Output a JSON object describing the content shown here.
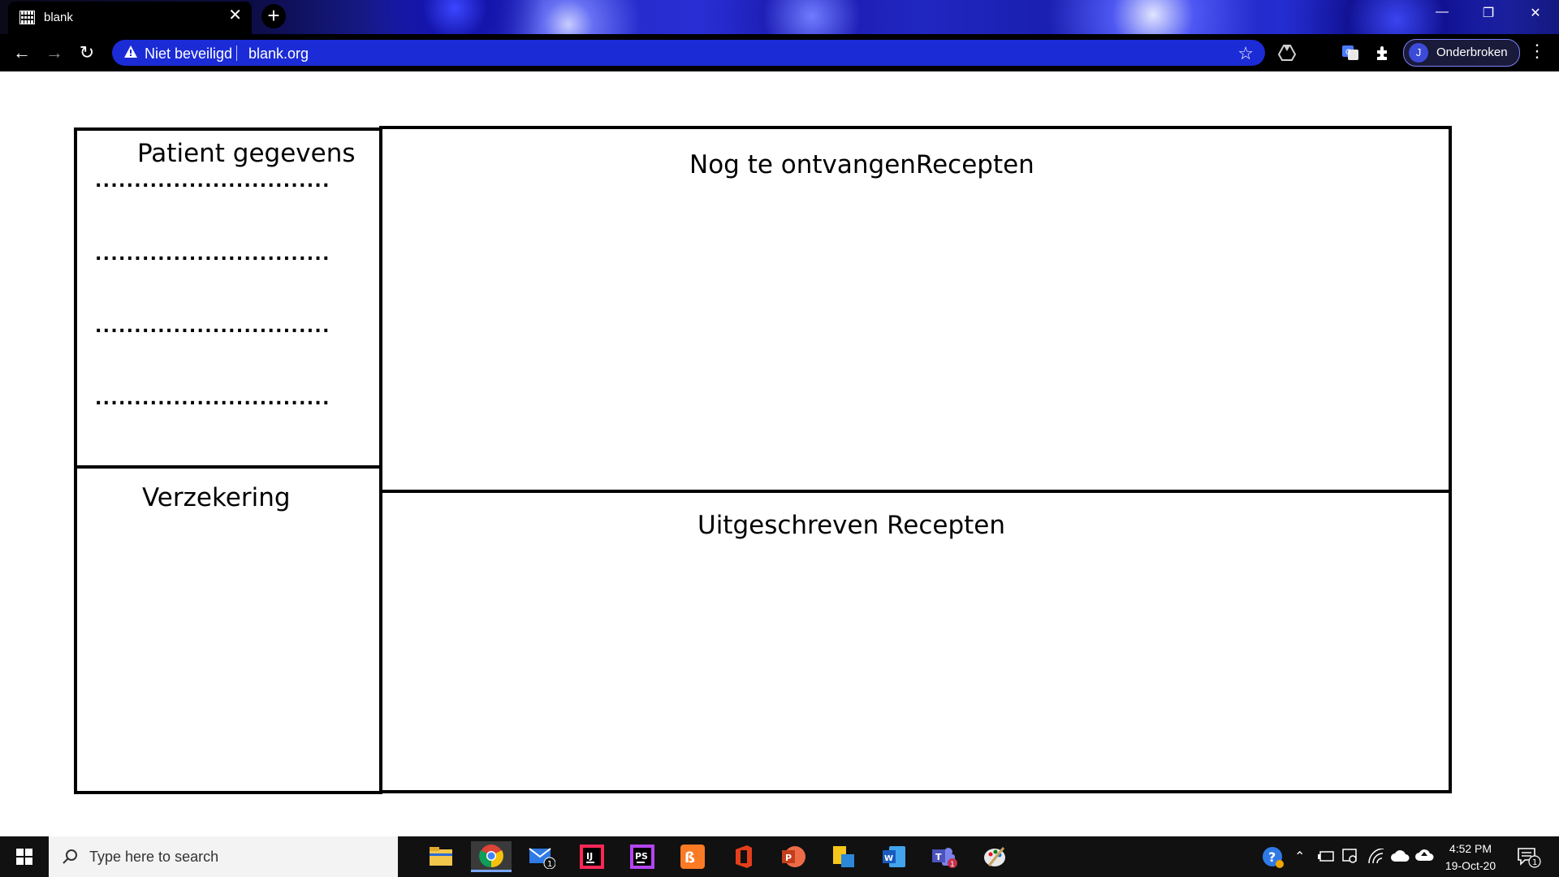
{
  "browser": {
    "tab_title": "blank",
    "tab_close": "✕",
    "new_tab": "+",
    "window_controls": {
      "minimize": "—",
      "restore": "❐",
      "close": "✕"
    },
    "nav": {
      "back": "←",
      "forward": "→",
      "reload": "↻"
    },
    "omnibox": {
      "security_text": "Niet beveiligd",
      "url": "blank.org",
      "warning_icon": "warning-triangle-icon",
      "star_icon": "bookmark-star-icon"
    },
    "profile": {
      "initial": "J",
      "name": "Onderbroken"
    },
    "menu": "⋮",
    "colors": {
      "toolbar": "#000000",
      "omnibox": "#1b2bd6"
    }
  },
  "page": {
    "patient_title": "Patient gegevens",
    "dotted_lines": [
      "..............................",
      "..............................",
      "..............................",
      ".............................."
    ],
    "insurance_title": "Verzekering",
    "pending_title": "Nog te ontvangenRecepten",
    "written_title": "Uitgeschreven Recepten"
  },
  "taskbar": {
    "search_placeholder": "Type here to search",
    "apps": [
      "file-explorer-icon",
      "chrome-icon",
      "mail-icon",
      "intellij-icon",
      "phpstorm-icon",
      "xampp-icon",
      "office-icon",
      "powerpoint-icon",
      "sticky-files-icon",
      "word-icon",
      "teams-icon",
      "paint-icon"
    ],
    "mail_badge": "1",
    "teams_badge": "1",
    "clock_time": "4:52 PM",
    "clock_date": "19-Oct-20",
    "notification_count": "1"
  }
}
